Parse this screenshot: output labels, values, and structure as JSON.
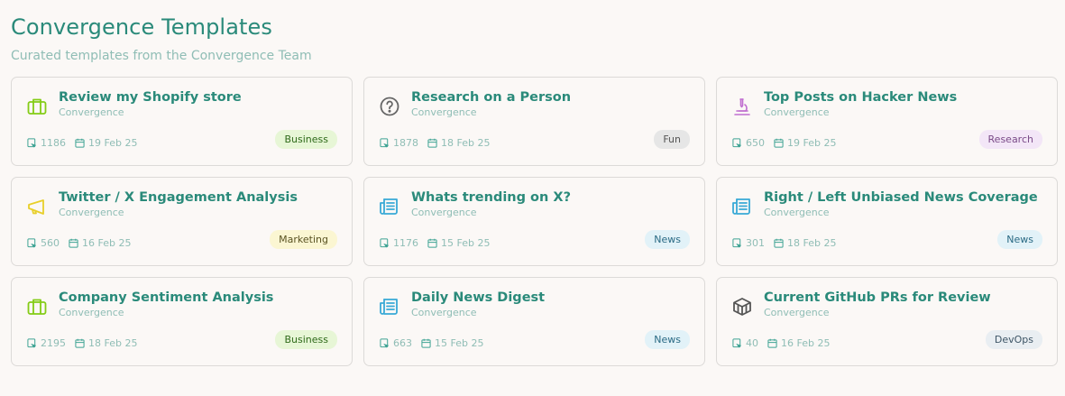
{
  "header": {
    "title": "Convergence Templates",
    "subtitle": "Curated templates from the Convergence Team"
  },
  "cards": [
    {
      "title": "Review my Shopify store",
      "author": "Convergence",
      "count": "1186",
      "date": "19 Feb 25",
      "tag": "Business",
      "icon": "briefcase-icon",
      "icon_color": "#84cc16",
      "tag_bg": "#e7f6d6",
      "tag_fg": "#2f6a1a"
    },
    {
      "title": "Research on a Person",
      "author": "Convergence",
      "count": "1878",
      "date": "18 Feb 25",
      "tag": "Fun",
      "icon": "question-icon",
      "icon_color": "#666666",
      "tag_bg": "#e6e6e6",
      "tag_fg": "#555555"
    },
    {
      "title": "Top Posts on Hacker News",
      "author": "Convergence",
      "count": "650",
      "date": "19 Feb 25",
      "tag": "Research",
      "icon": "microscope-icon",
      "icon_color": "#c06fd0",
      "tag_bg": "#f3e6f7",
      "tag_fg": "#7a4a88"
    },
    {
      "title": "Twitter / X Engagement Analysis",
      "author": "Convergence",
      "count": "560",
      "date": "16 Feb 25",
      "tag": "Marketing",
      "icon": "megaphone-icon",
      "icon_color": "#e8cf2a",
      "tag_bg": "#fbf6d2",
      "tag_fg": "#5a5322"
    },
    {
      "title": "Whats trending on X?",
      "author": "Convergence",
      "count": "1176",
      "date": "15 Feb 25",
      "tag": "News",
      "icon": "newspaper-icon",
      "icon_color": "#38a9d6",
      "tag_bg": "#e2f2f8",
      "tag_fg": "#2a6a84"
    },
    {
      "title": "Right / Left Unbiased News Coverage",
      "author": "Convergence",
      "count": "301",
      "date": "18 Feb 25",
      "tag": "News",
      "icon": "newspaper-icon",
      "icon_color": "#38a9d6",
      "tag_bg": "#e2f2f8",
      "tag_fg": "#2a6a84"
    },
    {
      "title": "Company Sentiment Analysis",
      "author": "Convergence",
      "count": "2195",
      "date": "18 Feb 25",
      "tag": "Business",
      "icon": "briefcase-icon",
      "icon_color": "#84cc16",
      "tag_bg": "#e7f6d6",
      "tag_fg": "#2f6a1a"
    },
    {
      "title": "Daily News Digest",
      "author": "Convergence",
      "count": "663",
      "date": "15 Feb 25",
      "tag": "News",
      "icon": "newspaper-icon",
      "icon_color": "#38a9d6",
      "tag_bg": "#e2f2f8",
      "tag_fg": "#2a6a84"
    },
    {
      "title": "Current GitHub PRs for Review",
      "author": "Convergence",
      "count": "40",
      "date": "16 Feb 25",
      "tag": "DevOps",
      "icon": "cube-icon",
      "icon_color": "#555555",
      "tag_bg": "#e9eef2",
      "tag_fg": "#3e5566"
    }
  ]
}
